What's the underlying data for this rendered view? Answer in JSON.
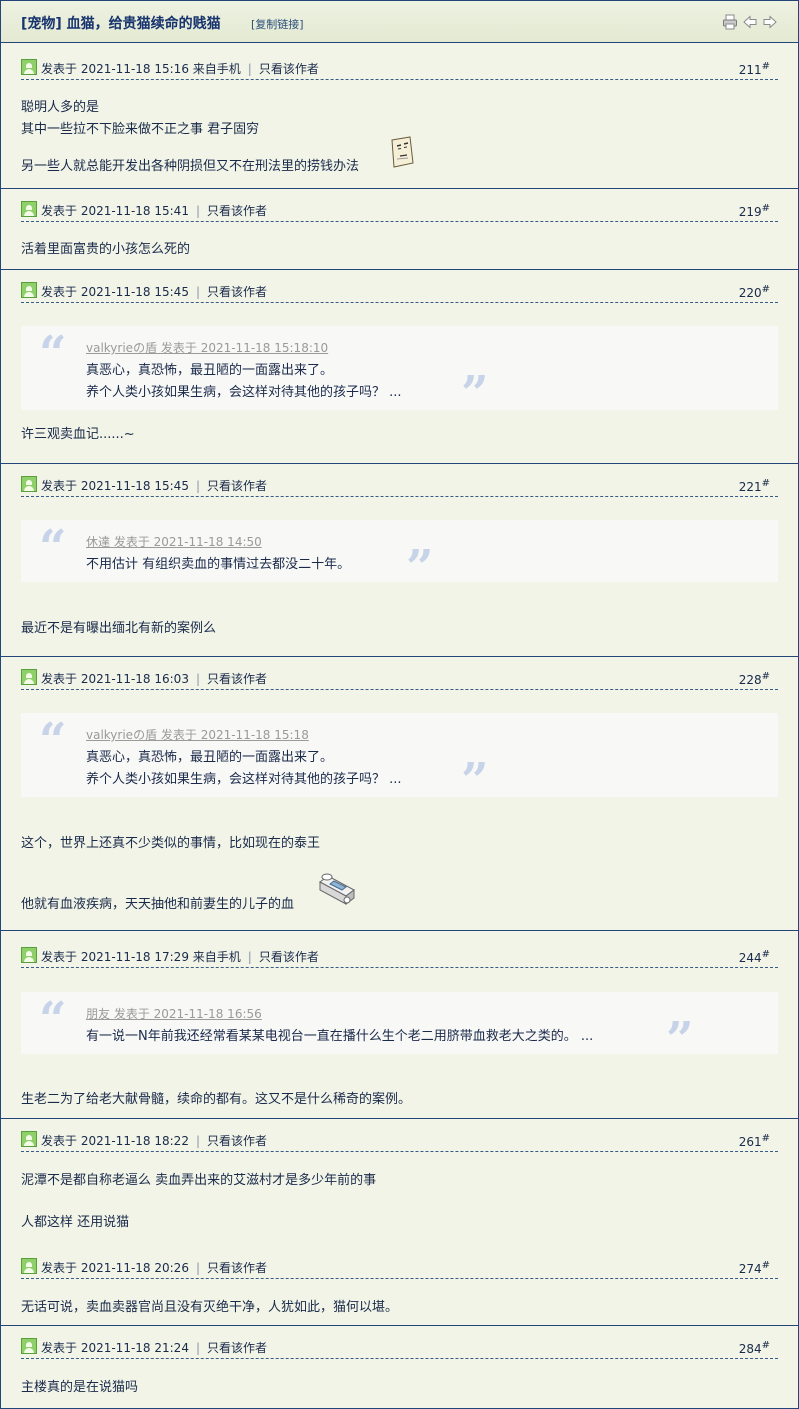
{
  "title": "[宠物] 血猫，给贵猫续命的贱猫",
  "copy_link": "[复制链接]",
  "icons": {
    "print": "print-icon",
    "prev": "arrow-left-icon",
    "next": "arrow-right-icon"
  },
  "posts": [
    {
      "meta": "发表于 2021-11-18 15:16 来自手机",
      "author_only": "只看该作者",
      "floor": "211",
      "floor_mark": "#",
      "lines": [
        "聪明人多的是",
        "其中一些拉不下脸来做不正之事 君子固穷",
        "另一些人就总能开发出各种阴损但又不在刑法里的捞钱办法"
      ]
    },
    {
      "meta": "发表于 2021-11-18 15:41",
      "author_only": "只看该作者",
      "floor": "219",
      "floor_mark": "#",
      "lines": [
        "活着里面富贵的小孩怎么死的"
      ]
    },
    {
      "meta": "发表于 2021-11-18 15:45",
      "author_only": "只看该作者",
      "floor": "220",
      "floor_mark": "#",
      "quote": {
        "author": "valkyrieの盾 发表于 2021-11-18 15:18:10",
        "lines": [
          "真恶心，真恐怖，最丑陋的一面露出来了。",
          "养个人类小孩如果生病，会这样对待其他的孩子吗？ ..."
        ]
      },
      "lines": [
        "许三观卖血记......~"
      ]
    },
    {
      "meta": "发表于 2021-11-18 15:45",
      "author_only": "只看该作者",
      "floor": "221",
      "floor_mark": "#",
      "quote": {
        "author": "休達 发表于 2021-11-18 14:50",
        "lines": [
          "不用估计 有组织卖血的事情过去都没二十年。"
        ]
      },
      "lines": [
        "最近不是有曝出缅北有新的案例么"
      ]
    },
    {
      "meta": "发表于 2021-11-18 16:03",
      "author_only": "只看该作者",
      "floor": "228",
      "floor_mark": "#",
      "quote": {
        "author": "valkyrieの盾 发表于 2021-11-18 15:18",
        "lines": [
          "真恶心，真恐怖，最丑陋的一面露出来了。",
          "养个人类小孩如果生病，会这样对待其他的孩子吗？ ..."
        ]
      },
      "lines": [
        "这个，世界上还真不少类似的事情，比如现在的泰王",
        "他就有血液疾病，天天抽他和前妻生的儿子的血"
      ]
    },
    {
      "meta": "发表于 2021-11-18 17:29 来自手机",
      "author_only": "只看该作者",
      "floor": "244",
      "floor_mark": "#",
      "quote": {
        "author": "朋友 发表于 2021-11-18 16:56",
        "lines": [
          "有一说一N年前我还经常看某某电视台一直在播什么生个老二用脐带血救老大之类的。 ..."
        ]
      },
      "lines": [
        "生老二为了给老大献骨髓，续命的都有。这又不是什么稀奇的案例。"
      ]
    },
    {
      "meta": "发表于 2021-11-18 18:22",
      "author_only": "只看该作者",
      "floor": "261",
      "floor_mark": "#",
      "lines": [
        "泥潭不是都自称老逼么 卖血弄出来的艾滋村才是多少年前的事",
        "人都这样  还用说猫"
      ]
    },
    {
      "meta": "发表于 2021-11-18 20:26",
      "author_only": "只看该作者",
      "floor": "274",
      "floor_mark": "#",
      "lines": [
        "无话可说，卖血卖器官尚且没有灭绝干净，人犹如此，猫何以堪。"
      ]
    },
    {
      "meta": "发表于 2021-11-18 21:24",
      "author_only": "只看该作者",
      "floor": "284",
      "floor_mark": "#",
      "lines": [
        "主楼真的是在说猫吗"
      ]
    }
  ]
}
